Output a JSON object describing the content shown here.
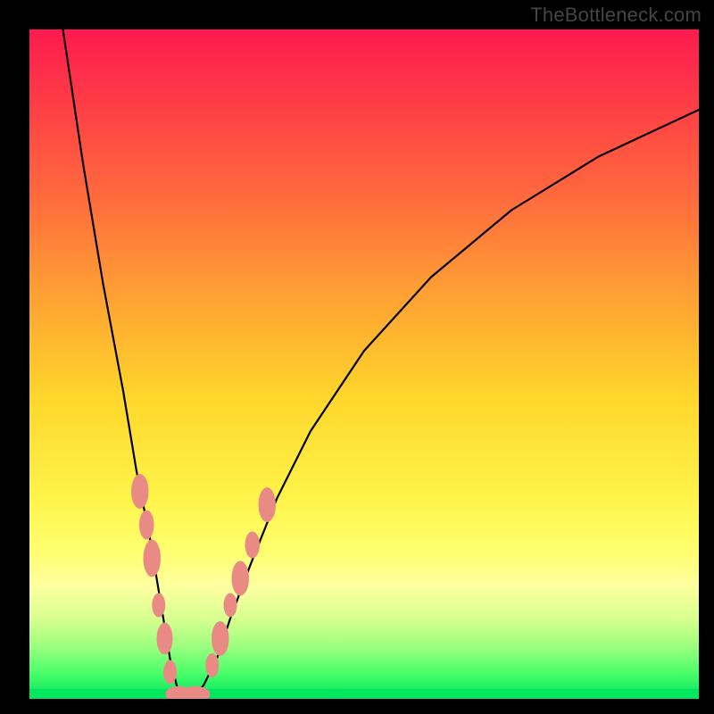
{
  "attribution": "TheBottleneck.com",
  "chart_data": {
    "type": "line",
    "title": "",
    "xlabel": "",
    "ylabel": "",
    "xlim": [
      0,
      100
    ],
    "ylim": [
      0,
      100
    ],
    "grid": false,
    "series": [
      {
        "name": "bottleneck-curve",
        "x": [
          5,
          8,
          11,
          14,
          16,
          18,
          19,
          20,
          21,
          22,
          23,
          24,
          26,
          28,
          30,
          33,
          37,
          42,
          50,
          60,
          72,
          85,
          100
        ],
        "y": [
          100,
          80,
          62,
          46,
          34,
          24,
          18,
          12,
          6,
          2,
          0,
          0,
          2,
          6,
          12,
          20,
          30,
          40,
          52,
          63,
          73,
          81,
          88
        ],
        "color": "#000000"
      }
    ],
    "markers": [
      {
        "name": "highlight-dots",
        "color": "#e98b84",
        "points": [
          {
            "x": 16.5,
            "y": 31,
            "rx": 1.3,
            "ry": 2.6
          },
          {
            "x": 17.5,
            "y": 26,
            "rx": 1.1,
            "ry": 2.2
          },
          {
            "x": 18.3,
            "y": 21,
            "rx": 1.3,
            "ry": 2.8
          },
          {
            "x": 19.3,
            "y": 14,
            "rx": 1.0,
            "ry": 1.8
          },
          {
            "x": 20.2,
            "y": 9,
            "rx": 1.2,
            "ry": 2.4
          },
          {
            "x": 21.0,
            "y": 4,
            "rx": 1.0,
            "ry": 1.8
          },
          {
            "x": 22.3,
            "y": 0.7,
            "rx": 2.0,
            "ry": 1.2
          },
          {
            "x": 24.8,
            "y": 0.7,
            "rx": 2.2,
            "ry": 1.2
          },
          {
            "x": 27.3,
            "y": 5,
            "rx": 1.0,
            "ry": 1.8
          },
          {
            "x": 28.5,
            "y": 9,
            "rx": 1.3,
            "ry": 2.6
          },
          {
            "x": 30.0,
            "y": 14,
            "rx": 1.0,
            "ry": 1.8
          },
          {
            "x": 31.5,
            "y": 18,
            "rx": 1.3,
            "ry": 2.6
          },
          {
            "x": 33.3,
            "y": 23,
            "rx": 1.1,
            "ry": 2.0
          },
          {
            "x": 35.5,
            "y": 29,
            "rx": 1.3,
            "ry": 2.6
          }
        ]
      }
    ],
    "bottom_band": {
      "color": "#00e65f",
      "y": 0,
      "height_pct": 1.5
    }
  }
}
